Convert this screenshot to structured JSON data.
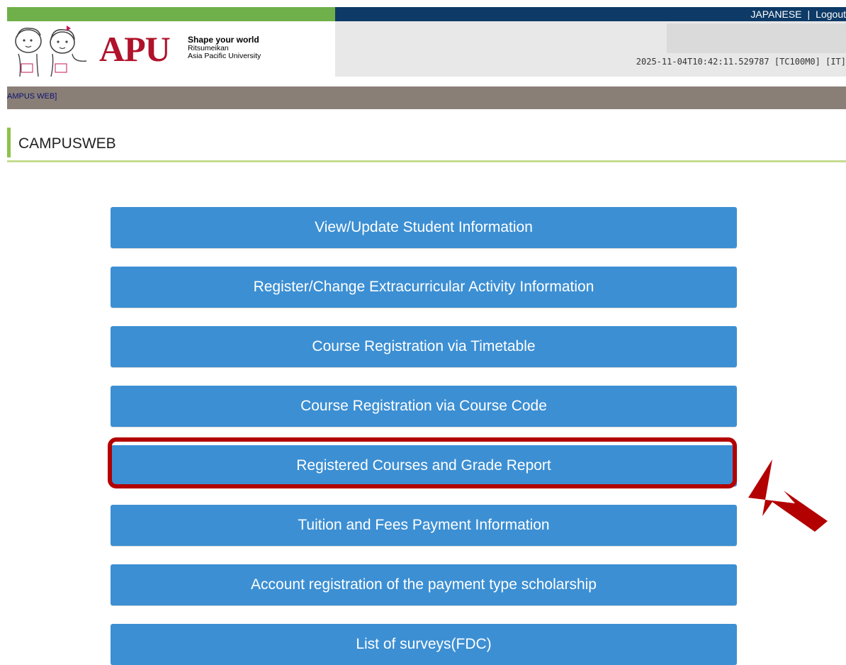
{
  "header": {
    "language_link": "JAPANESE",
    "separator": "|",
    "logout_link": "Logout",
    "timestamp": "2025-11-04T10:42:11.529787 [TC100M0] [IT]",
    "logo_text": "APU",
    "tagline": "Shape your world",
    "university_line1": "Ritsumeikan",
    "university_line2": "Asia Pacific University"
  },
  "breadcrumb": "AMPUS WEB]",
  "section_title": "CAMPUSWEB",
  "menu": [
    {
      "label": "View/Update Student Information"
    },
    {
      "label": "Register/Change Extracurricular Activity Information"
    },
    {
      "label": "Course Registration via Timetable"
    },
    {
      "label": "Course Registration via Course Code"
    },
    {
      "label": "Registered Courses and Grade Report"
    },
    {
      "label": "Tuition and Fees Payment Information"
    },
    {
      "label": "Account registration of the payment type scholarship"
    },
    {
      "label": "List of surveys(FDC)"
    }
  ],
  "colors": {
    "button": "#3c8fd3",
    "highlight": "#b30000",
    "header_navy": "#0d3a66",
    "header_green": "#6fb04a"
  },
  "icons": [
    "mascot-icon",
    "arrow-pointer-icon"
  ]
}
